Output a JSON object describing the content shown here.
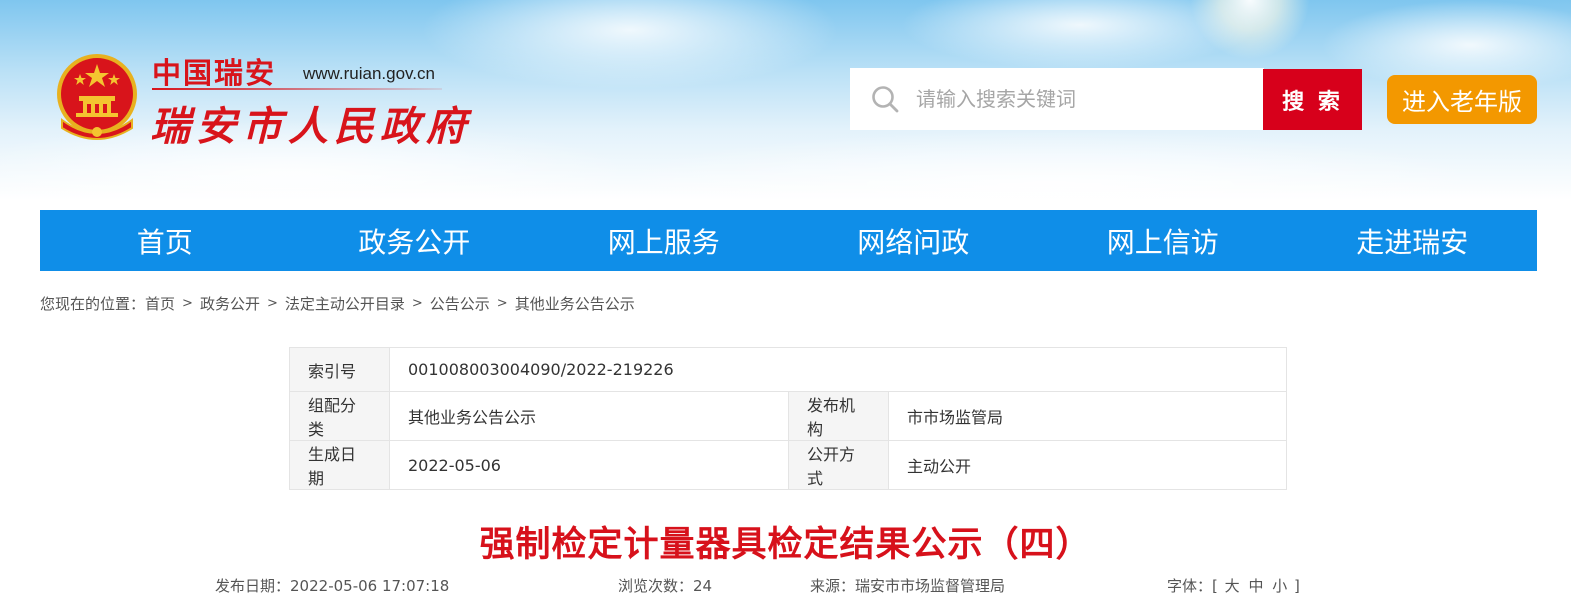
{
  "header": {
    "logo_cn": "中国瑞安",
    "logo_url": "www.ruian.gov.cn",
    "logo_name": "瑞安市人民政府",
    "search": {
      "placeholder": "请输入搜索关键词",
      "button_label": "搜 索"
    },
    "elder_mode_label": "进入老年版"
  },
  "colors": {
    "nav_bg": "#0f8ee8",
    "search_button": "#d7001b",
    "elder_button": "#f39800",
    "title_red": "#d7111b"
  },
  "nav": {
    "items": [
      {
        "label": "首页"
      },
      {
        "label": "政务公开"
      },
      {
        "label": "网上服务"
      },
      {
        "label": "网络问政"
      },
      {
        "label": "网上信访"
      },
      {
        "label": "走进瑞安"
      }
    ]
  },
  "breadcrumb": {
    "prefix": "您现在的位置：",
    "items": [
      {
        "label": "首页"
      },
      {
        "label": "政务公开"
      },
      {
        "label": "法定主动公开目录"
      },
      {
        "label": "公告公示"
      },
      {
        "label": "其他业务公告公示"
      }
    ],
    "separator": ">"
  },
  "meta": {
    "index_label": "索引号",
    "index_value": "001008003004090/2022-219226",
    "category_label": "组配分类",
    "category_value": "其他业务公告公示",
    "publisher_label": "发布机构",
    "publisher_value": "市市场监管局",
    "date_label": "生成日期",
    "date_value": "2022-05-06",
    "mode_label": "公开方式",
    "mode_value": "主动公开"
  },
  "article": {
    "title": "强制检定计量器具检定结果公示（四）",
    "publish_label": "发布日期：",
    "publish_value": "2022-05-06 17:07:18",
    "views_label": "浏览次数：",
    "views_value": "24",
    "source_label": "来源：",
    "source_value": "瑞安市市场监督管理局",
    "font_label": "字体：",
    "font_open": "[",
    "font_large": "大",
    "font_medium": "中",
    "font_small": "小",
    "font_close": "]"
  }
}
